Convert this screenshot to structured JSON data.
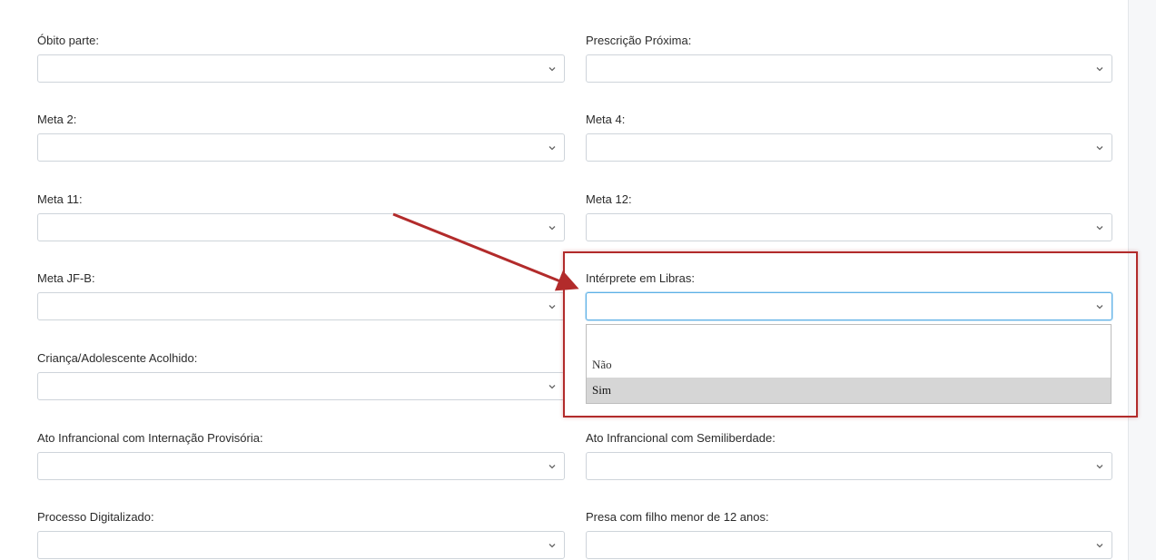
{
  "form": {
    "obito_parte": {
      "label": "Óbito parte:",
      "value": ""
    },
    "prescricao_proxima": {
      "label": "Prescrição Próxima:",
      "value": ""
    },
    "meta2": {
      "label": "Meta 2:",
      "value": ""
    },
    "meta4": {
      "label": "Meta 4:",
      "value": ""
    },
    "meta11": {
      "label": "Meta 11:",
      "value": ""
    },
    "meta12": {
      "label": "Meta 12:",
      "value": ""
    },
    "meta_jfb": {
      "label": "Meta JF-B:",
      "value": ""
    },
    "interprete_libras": {
      "label": "Intérprete em Libras:",
      "value": "",
      "options": [
        "",
        "Não",
        "Sim"
      ],
      "highlighted_option": "Sim"
    },
    "crianca_acolhido": {
      "label": "Criança/Adolescente Acolhido:",
      "value": ""
    },
    "ato_internacao": {
      "label": "Ato Infrancional com Internação Provisória:",
      "value": ""
    },
    "ato_semiliberdade": {
      "label": "Ato Infrancional com Semiliberdade:",
      "value": ""
    },
    "processo_digitalizado": {
      "label": "Processo Digitalizado:",
      "value": ""
    },
    "presa_filho": {
      "label": "Presa com filho menor de 12 anos:",
      "value": ""
    }
  },
  "annotation": {
    "color": "#b22b2b"
  },
  "icons": {
    "select_chevron": "chevron-down-icon"
  }
}
